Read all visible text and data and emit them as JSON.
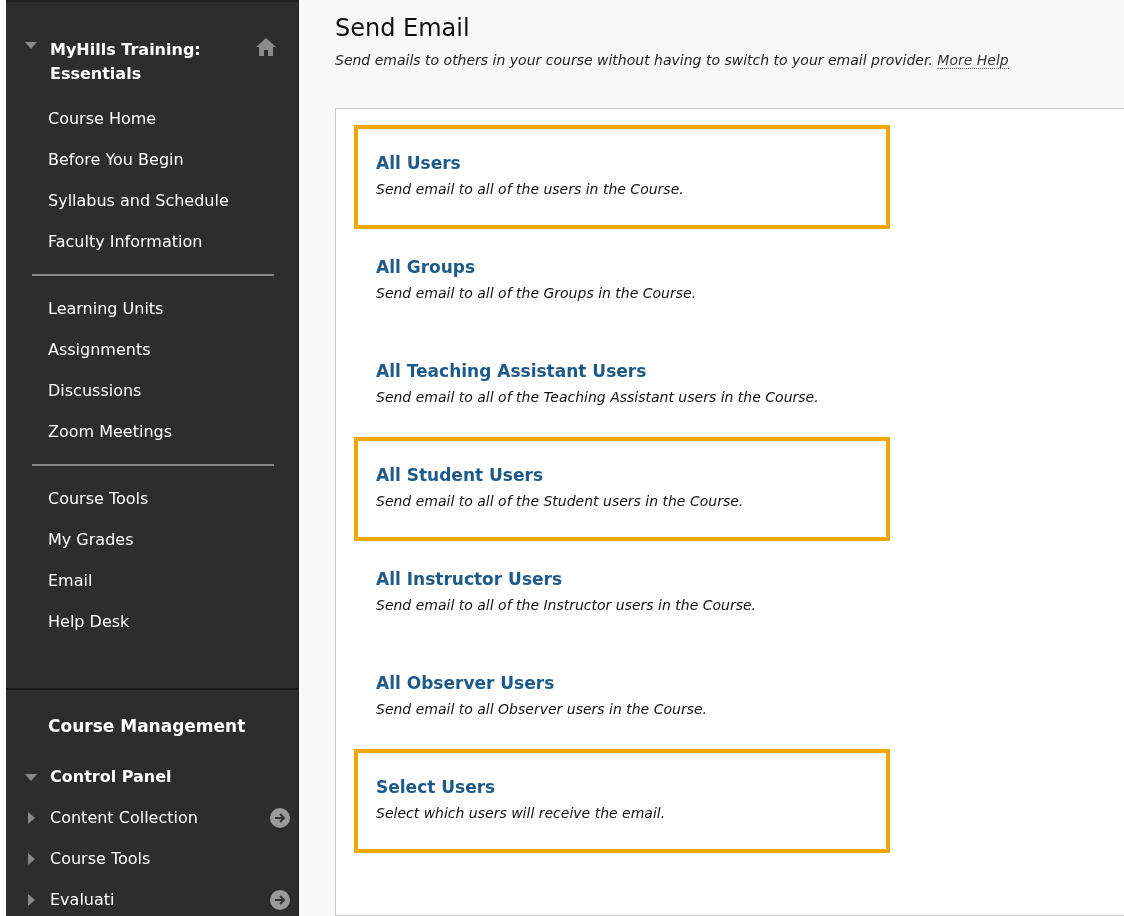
{
  "sidebar": {
    "course": {
      "title": "MyHills Training: Essentials",
      "expanded": true
    },
    "groups": [
      {
        "items": [
          "Course Home",
          "Before You Begin",
          "Syllabus and Schedule",
          "Faculty Information"
        ]
      },
      {
        "items": [
          "Learning Units",
          "Assignments",
          "Discussions",
          "Zoom Meetings"
        ]
      },
      {
        "items": [
          "Course Tools",
          "My Grades",
          "Email",
          "Help Desk"
        ]
      }
    ],
    "management": {
      "title": "Course Management",
      "panel": {
        "title": "Control Panel",
        "expanded": true
      },
      "items": [
        {
          "label": "Content Collection",
          "expanded": false,
          "go": true
        },
        {
          "label": "Course Tools",
          "expanded": false,
          "go": false
        },
        {
          "label": "Evaluati",
          "expanded": false,
          "go": true
        }
      ]
    }
  },
  "page": {
    "title": "Send Email",
    "description": "Send emails to others in your course without having to switch to your email provider.",
    "help_link": "More Help"
  },
  "options": [
    {
      "title": "All Users",
      "description": "Send email to all of the users in the Course.",
      "highlighted": true
    },
    {
      "title": "All Groups",
      "description": "Send email to all of the Groups in the Course.",
      "highlighted": false
    },
    {
      "title": "All Teaching Assistant Users",
      "description": "Send email to all of the Teaching Assistant users in the Course.",
      "highlighted": false
    },
    {
      "title": "All Student Users",
      "description": "Send email to all of the Student users in the Course.",
      "highlighted": true
    },
    {
      "title": "All Instructor Users",
      "description": "Send email to all of the Instructor users in the Course.",
      "highlighted": false
    },
    {
      "title": "All Observer Users",
      "description": "Send email to all Observer users in the Course.",
      "highlighted": false
    },
    {
      "title": "Select Users",
      "description": "Select which users will receive the email.",
      "highlighted": true
    }
  ]
}
